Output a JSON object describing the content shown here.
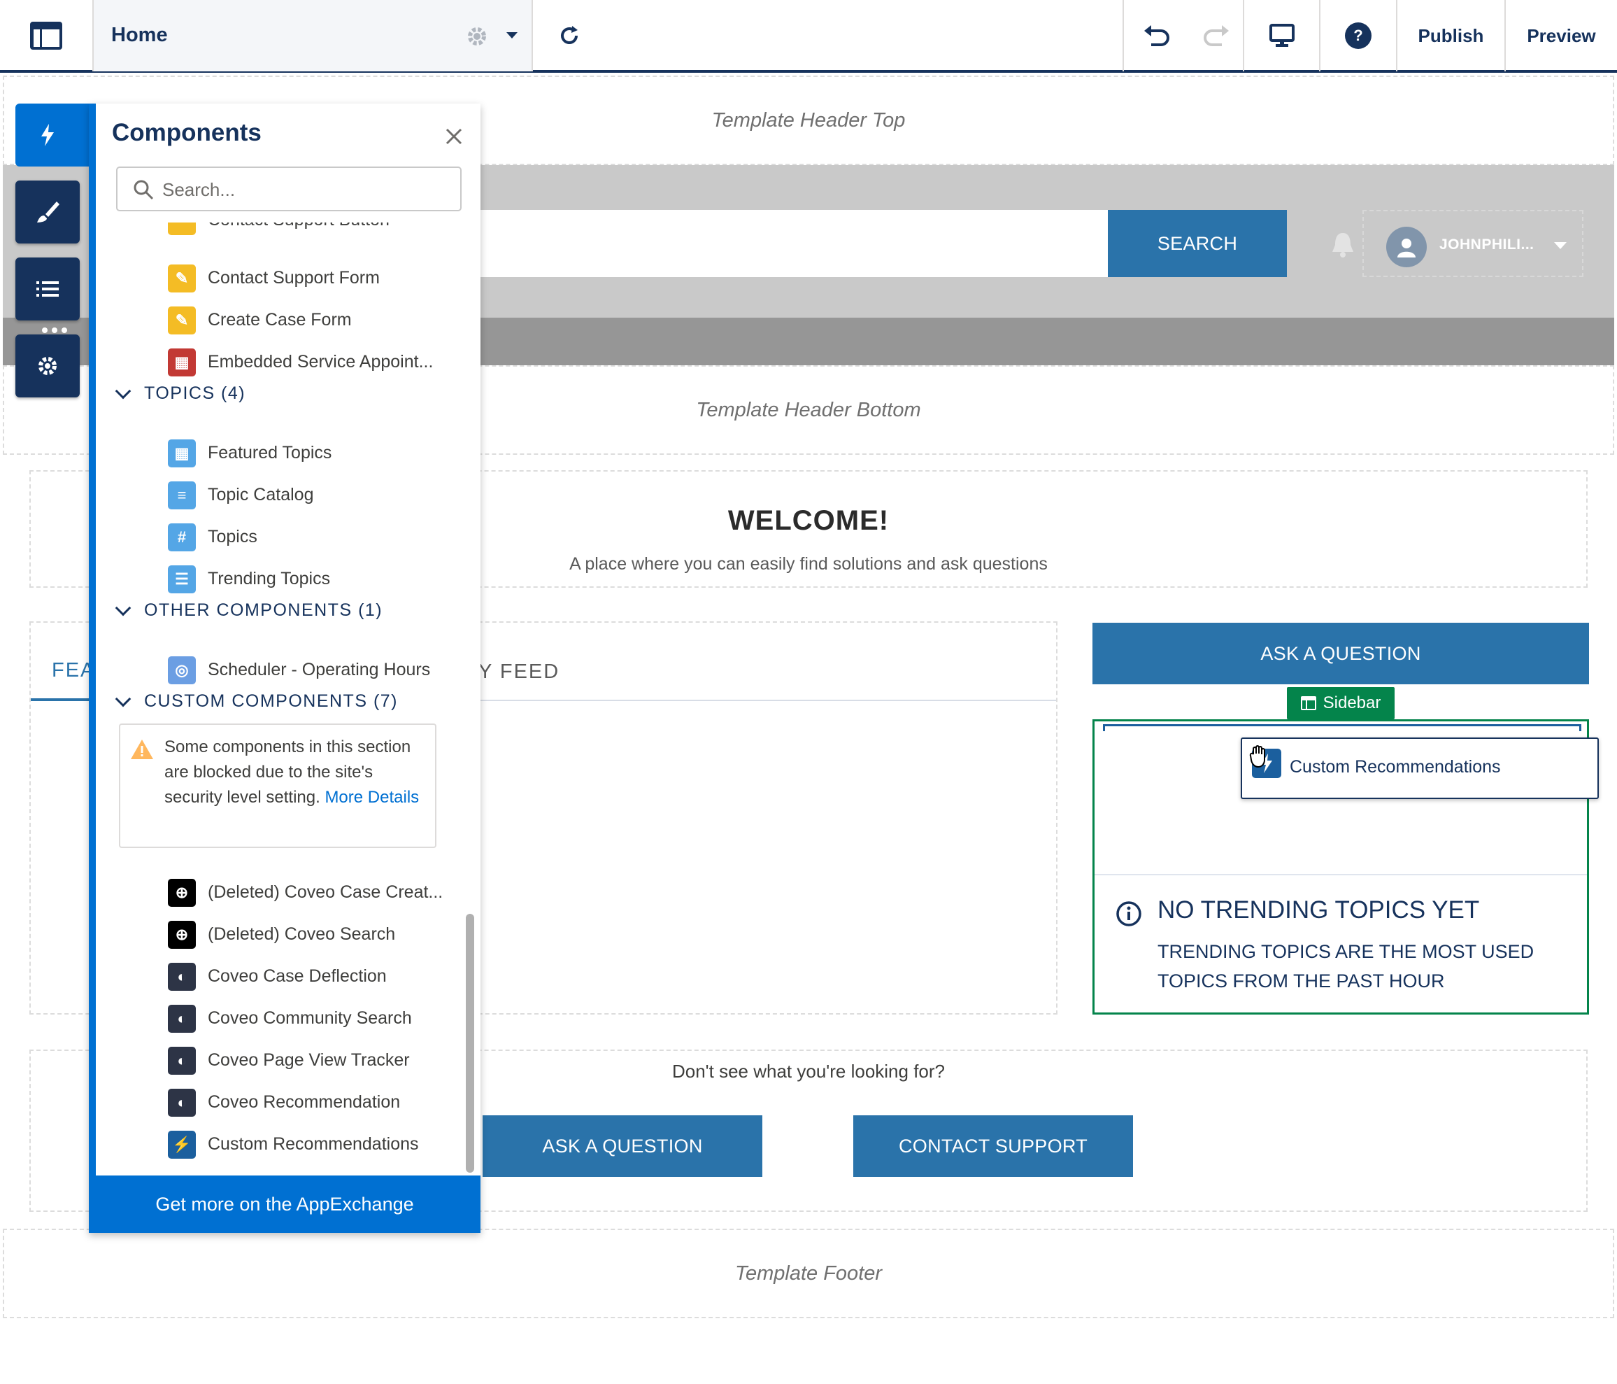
{
  "toolbar": {
    "page_name": "Home",
    "publish_label": "Publish",
    "preview_label": "Preview",
    "help_label": "?"
  },
  "canvas": {
    "template_header_top": "Template Header Top",
    "template_header_bottom": "Template Header Bottom",
    "template_footer": "Template Footer",
    "search_button": "SEARCH",
    "username": "JOHNPHILI...",
    "welcome_title": "WELCOME!",
    "welcome_subtitle": "A place where you can easily find solutions and ask questions",
    "tab_featured_partial": "FEA",
    "tab_feed_partial": "Y FEED",
    "ask_question_top": "ASK A QUESTION",
    "sidebar_tag": "Sidebar",
    "drag_item_label": "Custom Recommendations",
    "no_trending_title": "NO TRENDING TOPICS YET",
    "no_trending_desc_1": "TRENDING TOPICS ARE THE MOST USED",
    "no_trending_desc_2": "TOPICS FROM THE PAST HOUR",
    "dont_see": "Don't see what you're looking for?",
    "ask_question_bottom": "ASK A QUESTION",
    "contact_support": "CONTACT SUPPORT"
  },
  "panel": {
    "title": "Components",
    "search_placeholder": "Search...",
    "partial_item": "Contact Support Button",
    "items_support": [
      {
        "label": "Contact Support Form",
        "icon": "form-icon",
        "color": "#f4bc25"
      },
      {
        "label": "Create Case Form",
        "icon": "form-icon",
        "color": "#f4bc25"
      },
      {
        "label": "Embedded Service Appoint...",
        "icon": "calendar-icon",
        "color": "#c23934"
      }
    ],
    "section_topics": "TOPICS (4)",
    "items_topics": [
      {
        "label": "Featured Topics",
        "icon": "grid-icon",
        "color": "#54a6e6"
      },
      {
        "label": "Topic Catalog",
        "icon": "table-icon",
        "color": "#54a6e6"
      },
      {
        "label": "Topics",
        "icon": "hash-icon",
        "color": "#54a6e6"
      },
      {
        "label": "Trending Topics",
        "icon": "list-icon",
        "color": "#54a6e6"
      }
    ],
    "section_other": "OTHER COMPONENTS (1)",
    "items_other": [
      {
        "label": "Scheduler - Operating Hours",
        "icon": "scheduler-icon",
        "color": "#6b9ee3"
      }
    ],
    "section_custom": "CUSTOM COMPONENTS (7)",
    "warning_text": "Some components in this section are blocked due to the site's security level setting.",
    "warning_link": "More Details",
    "items_custom": [
      {
        "label": "(Deleted) Coveo Case Creat...",
        "icon": "coveo-deleted-icon",
        "color": "#000000"
      },
      {
        "label": "(Deleted) Coveo Search",
        "icon": "coveo-deleted-icon",
        "color": "#000000"
      },
      {
        "label": "Coveo Case Deflection",
        "icon": "coveo-icon",
        "color": "#2d3446"
      },
      {
        "label": "Coveo Community Search",
        "icon": "coveo-icon",
        "color": "#2d3446"
      },
      {
        "label": "Coveo Page View Tracker",
        "icon": "coveo-icon",
        "color": "#2d3446"
      },
      {
        "label": "Coveo Recommendation",
        "icon": "coveo-icon",
        "color": "#2d3446"
      },
      {
        "label": "Custom Recommendations",
        "icon": "lightning-icon",
        "color": "#1b5f9e"
      }
    ],
    "appexchange_label": "Get more on the AppExchange"
  }
}
